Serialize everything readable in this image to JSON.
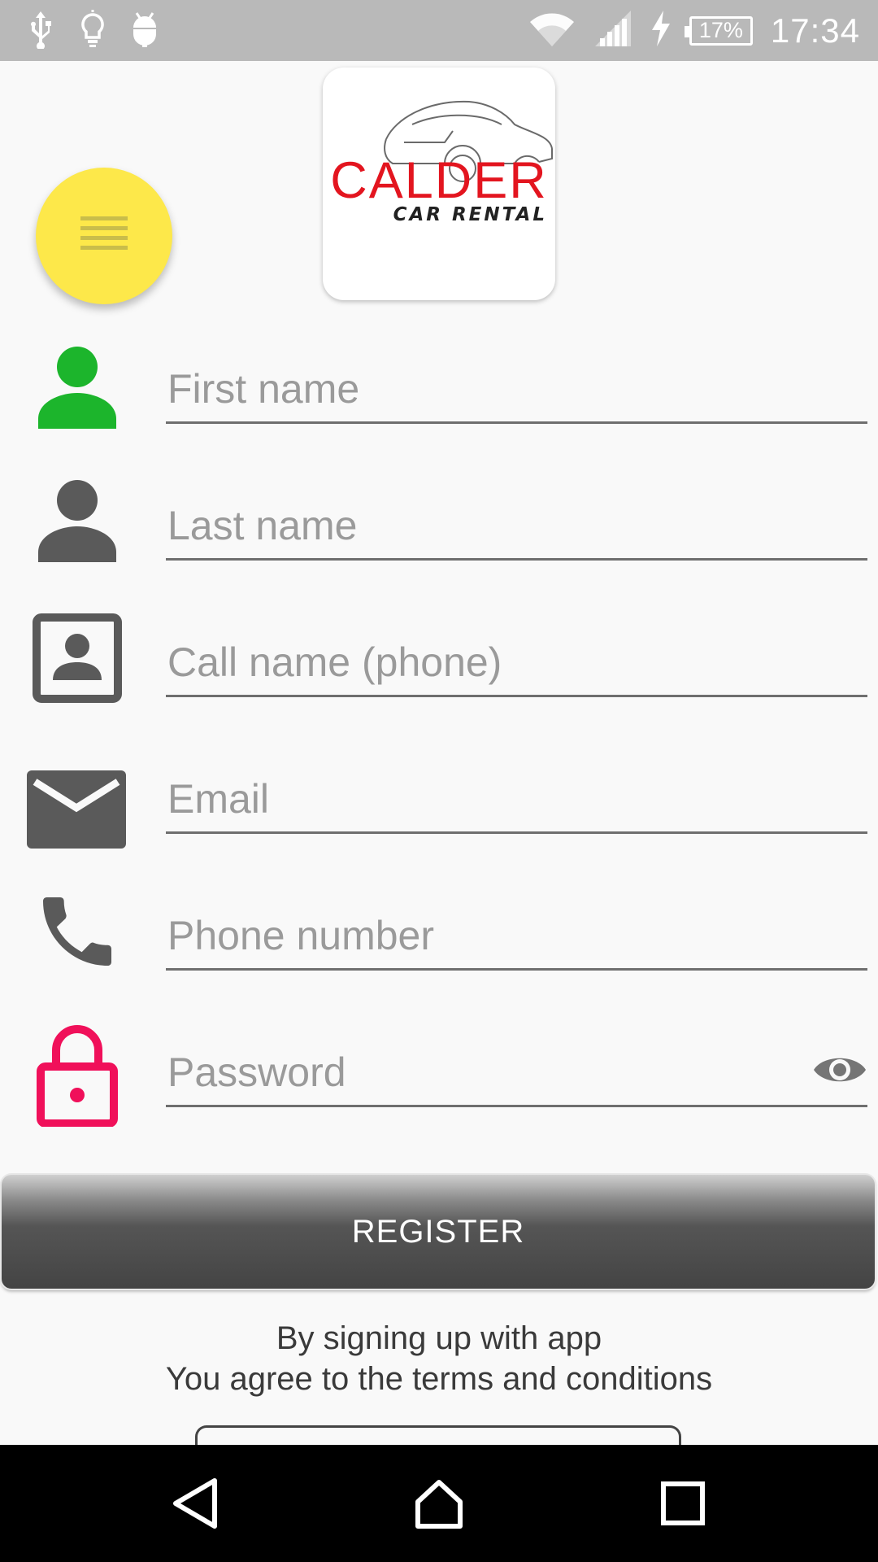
{
  "status_bar": {
    "battery": "17%",
    "time": "17:34",
    "left_icons": [
      "usb-icon",
      "lightbulb-icon",
      "android-debug-icon"
    ],
    "right_icons": [
      "wifi-icon",
      "signal-icon",
      "charging-icon"
    ]
  },
  "header": {
    "menu_icon": "hamburger-menu-icon",
    "menu_color": "#fde84a",
    "logo_text": "CALDER",
    "logo_subtext": "CAR RENTAL",
    "logo_color": "#e3151f"
  },
  "form": {
    "fields": [
      {
        "icon": "person-icon",
        "icon_color": "#1cb52c",
        "placeholder": "First name"
      },
      {
        "icon": "person-icon",
        "icon_color": "#5a5a5a",
        "placeholder": "Last name"
      },
      {
        "icon": "contact-card-icon",
        "icon_color": "#5a5a5a",
        "placeholder": "Call name (phone)"
      },
      {
        "icon": "email-icon",
        "icon_color": "#5a5a5a",
        "placeholder": "Email"
      },
      {
        "icon": "phone-icon",
        "icon_color": "#5a5a5a",
        "placeholder": "Phone number"
      },
      {
        "icon": "lock-icon",
        "icon_color": "#f0105a",
        "placeholder": "Password",
        "trailing_icon": "eye-icon"
      }
    ]
  },
  "register_button": {
    "label": "REGISTER"
  },
  "terms": {
    "line1": "By signing up with app",
    "line2": "You agree to the terms and conditions"
  },
  "nav_bar": {
    "buttons": [
      "back-icon",
      "home-icon",
      "recents-icon"
    ]
  }
}
